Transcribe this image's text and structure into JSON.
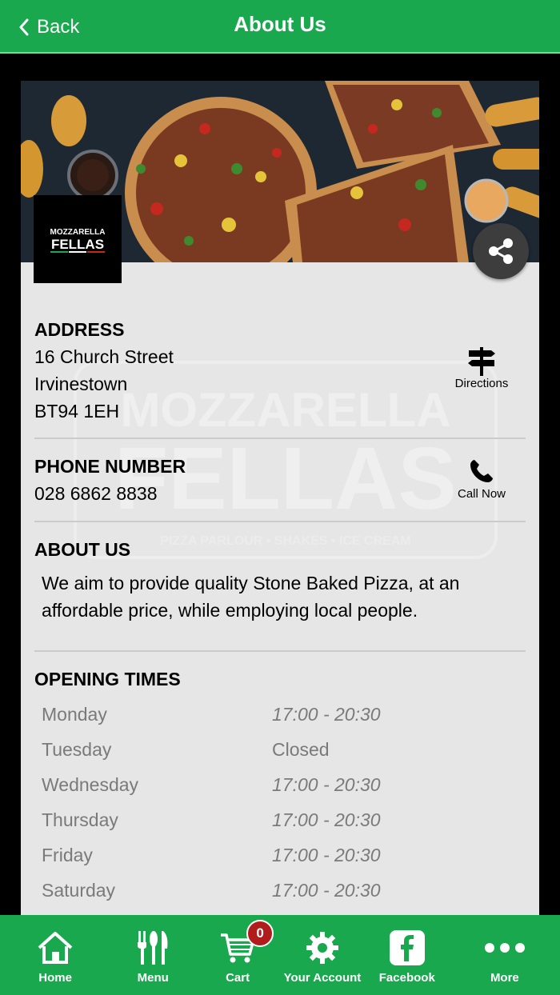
{
  "header": {
    "back_label": "Back",
    "title": "About Us"
  },
  "brand": {
    "logo_line1": "MOZZARELLA",
    "logo_line2": "FELLAS",
    "tagline": "PIZZA PARLOUR • SHAKES • ICE CREAM"
  },
  "address": {
    "heading": "ADDRESS",
    "line1": "16 Church Street",
    "line2": "Irvinestown",
    "line3": "BT94 1EH",
    "action_label": "Directions",
    "action_icon": "signpost-icon"
  },
  "phone": {
    "heading": "PHONE NUMBER",
    "number": "028 6862 8838",
    "action_label": "Call Now",
    "action_icon": "phone-icon"
  },
  "about": {
    "heading": "ABOUT US",
    "body": "We aim to provide quality Stone Baked Pizza, at an affordable price, while employing local people."
  },
  "opening": {
    "heading": "OPENING TIMES",
    "rows": [
      {
        "day": "Monday",
        "time": "17:00 - 20:30"
      },
      {
        "day": "Tuesday",
        "time": "Closed"
      },
      {
        "day": "Wednesday",
        "time": "17:00 - 20:30"
      },
      {
        "day": "Thursday",
        "time": "17:00 - 20:30"
      },
      {
        "day": "Friday",
        "time": "17:00 - 20:30"
      },
      {
        "day": "Saturday",
        "time": "17:00 - 20:30"
      }
    ]
  },
  "tabs": [
    {
      "label": "Home",
      "icon": "home-icon"
    },
    {
      "label": "Menu",
      "icon": "cutlery-icon"
    },
    {
      "label": "Cart",
      "icon": "cart-icon",
      "badge": "0"
    },
    {
      "label": "Your Account",
      "icon": "gear-icon"
    },
    {
      "label": "Facebook",
      "icon": "facebook-icon"
    },
    {
      "label": "More",
      "icon": "more-icon"
    }
  ],
  "colors": {
    "brand_green": "#1aa84f",
    "badge_red": "#b01c1c",
    "card_bg": "#e6e6e6"
  }
}
